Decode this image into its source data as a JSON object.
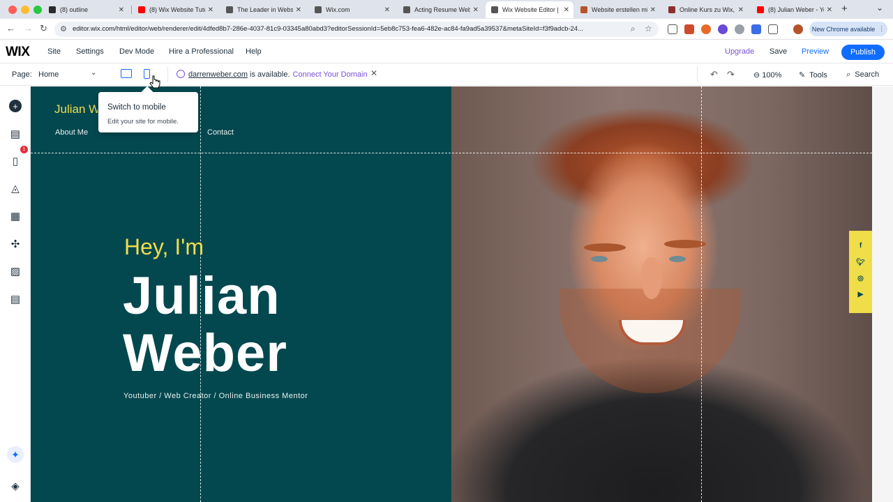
{
  "browser": {
    "tabs": [
      {
        "title": "(8) outline",
        "color": "#2b2b2b"
      },
      {
        "title": "(8) Wix Website Tuto",
        "color": "#ff0000"
      },
      {
        "title": "The Leader in Websit",
        "color": "#555555"
      },
      {
        "title": "Wix.com",
        "color": "#555555"
      },
      {
        "title": "Acting Resume Webs",
        "color": "#555555"
      },
      {
        "title": "Wix Website Editor |",
        "color": "#555555"
      },
      {
        "title": "Website erstellen mi",
        "color": "#b5532a"
      },
      {
        "title": "Online Kurs zu Wix, I",
        "color": "#8a2f2f"
      },
      {
        "title": "(8) Julian Weber - Yo",
        "color": "#ff0000"
      }
    ],
    "active_tab": 5,
    "url": "editor.wix.com/html/editor/web/renderer/edit/4dfed8b7-286e-4037-81c9-03345a80abd3?editorSessionId=5eb8c753-fea6-482e-ac84-fa9ad5a39537&metaSiteId=f3f9adcb-24...",
    "new_chrome": "New Chrome available"
  },
  "wix": {
    "logo": "WIX",
    "menu": {
      "site": "Site",
      "settings": "Settings",
      "dev_mode": "Dev Mode",
      "hire": "Hire a Professional",
      "help": "Help"
    },
    "upgrade": "Upgrade",
    "save": "Save",
    "preview": "Preview",
    "publish": "Publish",
    "page_label": "Page:",
    "page_value": "Home",
    "domain": {
      "name": "darrenweber.com",
      "available": " is available.",
      "connect": "Connect Your Domain"
    },
    "zoom": "100%",
    "tools": "Tools",
    "search": "Search",
    "colors": {
      "accent": "#116dff",
      "upgrade": "#7b4fd6",
      "canvas": "#04484f",
      "yellow": "#f0dd4a"
    }
  },
  "tooltip": {
    "title": "Switch to mobile",
    "subtitle": "Edit your site for mobile."
  },
  "site": {
    "logo": "Julian W",
    "nav": [
      "About Me",
      "Contact"
    ],
    "hey": "Hey, I'm",
    "name_line1": "Julian",
    "name_line2": "Weber",
    "tagline": "Youtuber / Web Creator / Online Business Mentor",
    "social": [
      "f",
      "t",
      "ig",
      "yt"
    ]
  },
  "rail_badge": "1"
}
